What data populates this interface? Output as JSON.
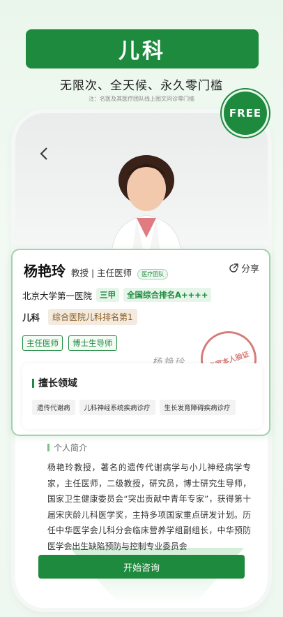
{
  "banner": {
    "title": "儿科"
  },
  "slogan": "无限次、全天候、永久零门槛",
  "note": "注：名医及其医疗团队线上图文问诊零门槛",
  "badge": {
    "label": "FREE",
    "color": "#1d8a3e"
  },
  "header": {
    "back_icon": "chevron-left-icon"
  },
  "doctor": {
    "name": "杨艳玲",
    "title": "教授 | 主任医师",
    "team_tag": "医疗团队",
    "share_label": "分享",
    "hospital": "北京大学第一医院",
    "hospital_level": "三甲",
    "ranking": "全国综合排名A++++",
    "department": "儿科",
    "department_rank": "综合医院儿科排名第1",
    "credentials": [
      "主任医师",
      "博士生导师"
    ],
    "stamp_text": "专家本人验证",
    "signature": "杨艳玲"
  },
  "skills": {
    "title": "擅长领域",
    "items": [
      "遗传代谢病",
      "儿科神经系统疾病诊疗",
      "生长发育障碍疾病诊疗"
    ]
  },
  "intro": {
    "title": "个人简介",
    "text": "杨艳玲教授，著名的遗传代谢病学与小儿神经病学专家，主任医师，二级教授，研究员，博士研究生导师，国家卫生健康委员会“突出贡献中青年专家”，获得第十届宋庆龄儿科医学奖，主持多项国家重点研发计划。历任中华医学会儿科分会临床营养学组副组长，中华预防医学会出生缺陷预防与控制专业委员会"
  },
  "cta": {
    "label": "开始咨询"
  },
  "colors": {
    "brand": "#1d8a3e",
    "accent_light": "#9fd3a8",
    "stamp": "#c9504a"
  }
}
